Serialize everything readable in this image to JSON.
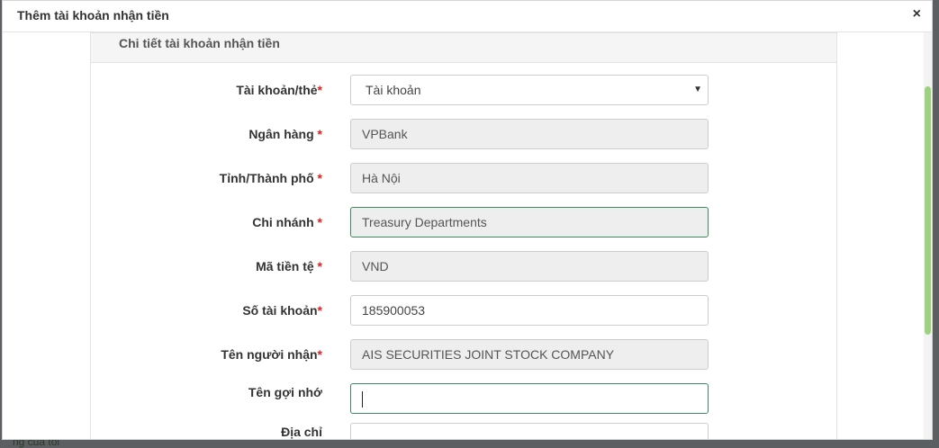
{
  "background": {
    "peek_text": "ng của tôi"
  },
  "modal": {
    "title": "Thêm tài khoản nhận tiền",
    "close_label": "×"
  },
  "panel": {
    "title": "Chi tiết tài khoản nhận tiền"
  },
  "fields": {
    "account_type": {
      "label": "Tài khoản/thẻ",
      "required": "*",
      "value": "Tài khoản"
    },
    "bank": {
      "label": "Ngân hàng ",
      "required": "*",
      "value": "VPBank"
    },
    "province": {
      "label": "Tỉnh/Thành phố ",
      "required": "*",
      "value": "Hà Nội"
    },
    "branch": {
      "label": "Chi nhánh ",
      "required": "*",
      "value": "Treasury Departments"
    },
    "currency": {
      "label": "Mã tiền tệ ",
      "required": "*",
      "value": "VND"
    },
    "account_number": {
      "label": "Số tài khoản",
      "required": "*",
      "value": "185900053"
    },
    "recipient_name": {
      "label": "Tên người nhận",
      "required": "*",
      "value": "AIS SECURITIES JOINT STOCK COMPANY"
    },
    "nickname": {
      "label": "Tên gợi nhớ",
      "value": ""
    },
    "address": {
      "label": "Địa chỉ",
      "value": ""
    }
  },
  "colors": {
    "focus_border": "#3c8a5e",
    "required": "#e02020",
    "scroll_thumb": "#9dd37e"
  }
}
